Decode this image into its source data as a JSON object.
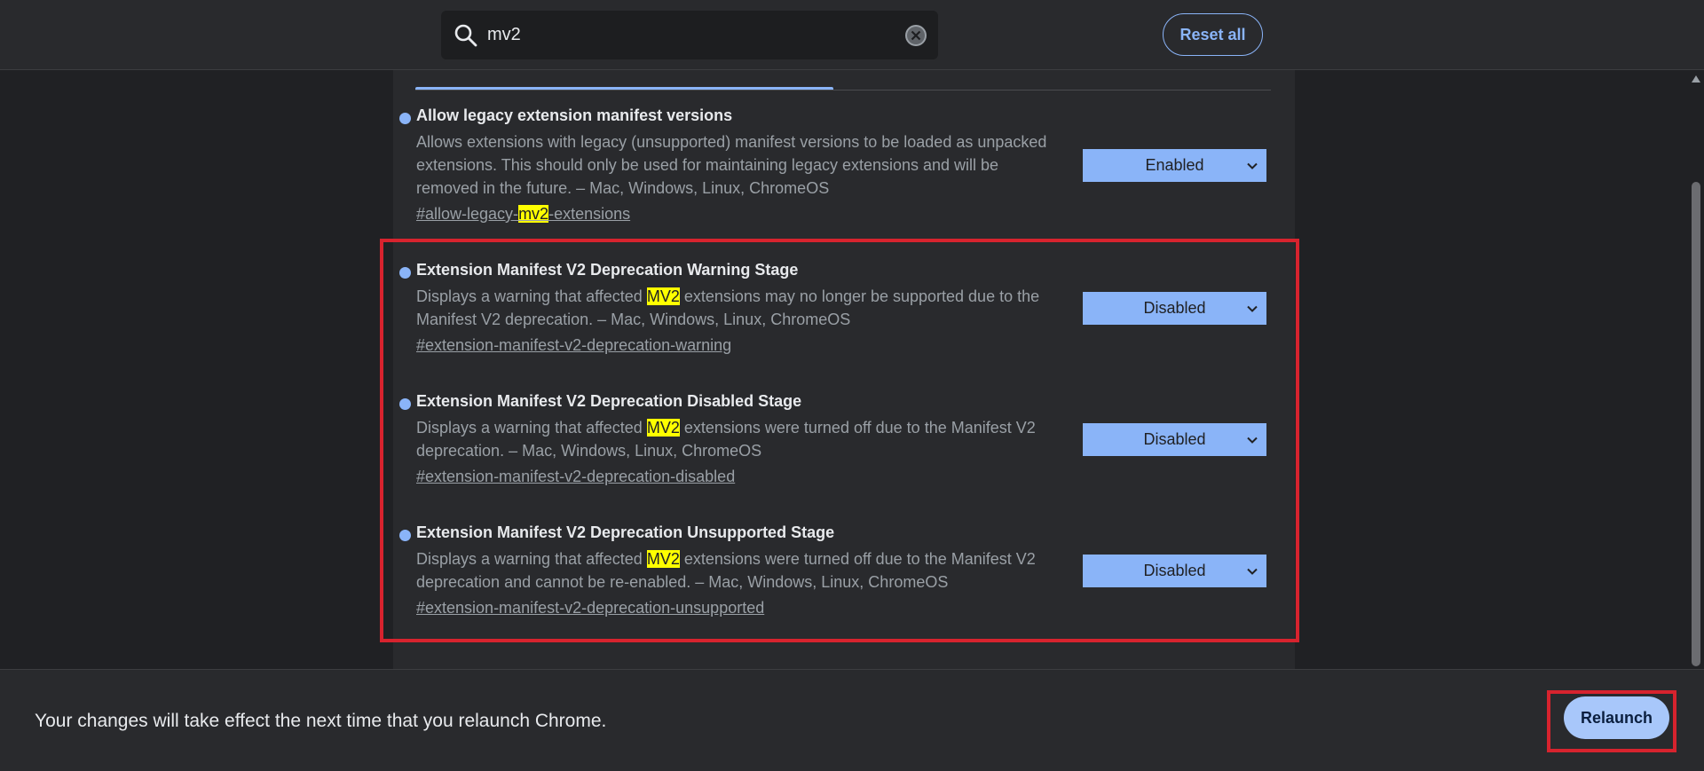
{
  "search": {
    "value": "mv2",
    "placeholder": "Search flags"
  },
  "header": {
    "reset_label": "Reset all"
  },
  "flags": [
    {
      "title": "Allow legacy extension manifest versions",
      "description": "Allows extensions with legacy (unsupported) manifest versions to be loaded as unpacked extensions. This should only be used for maintaining legacy extensions and will be removed in the future. – Mac, Windows, Linux, ChromeOS",
      "link_prefix": "#allow-legacy-",
      "link_highlight": "mv2",
      "link_suffix": "-extensions",
      "value": "Enabled"
    },
    {
      "title": "Extension Manifest V2 Deprecation Warning Stage",
      "desc_prefix": "Displays a warning that affected ",
      "desc_highlight": "MV2",
      "desc_suffix": " extensions may no longer be supported due to the Manifest V2 deprecation. – Mac, Windows, Linux, ChromeOS",
      "link": "#extension-manifest-v2-deprecation-warning",
      "value": "Disabled"
    },
    {
      "title": "Extension Manifest V2 Deprecation Disabled Stage",
      "desc_prefix": "Displays a warning that affected ",
      "desc_highlight": "MV2",
      "desc_suffix": " extensions were turned off due to the Manifest V2 deprecation. – Mac, Windows, Linux, ChromeOS",
      "link": "#extension-manifest-v2-deprecation-disabled",
      "value": "Disabled"
    },
    {
      "title": "Extension Manifest V2 Deprecation Unsupported Stage",
      "desc_prefix": "Displays a warning that affected ",
      "desc_highlight": "MV2",
      "desc_suffix": " extensions were turned off due to the Manifest V2 deprecation and cannot be re-enabled. – Mac, Windows, Linux, ChromeOS",
      "link": "#extension-manifest-v2-deprecation-unsupported",
      "value": "Disabled"
    }
  ],
  "footer": {
    "message": "Your changes will take effect the next time that you relaunch Chrome.",
    "relaunch_label": "Relaunch"
  },
  "colors": {
    "accent": "#8ab4f8",
    "highlight": "#ffff00",
    "annotation": "#d7232e",
    "background": "#202124",
    "surface": "#292a2d"
  },
  "icons": {
    "search": "search-icon",
    "clear": "clear-icon",
    "select": "chevron-down-icon"
  }
}
